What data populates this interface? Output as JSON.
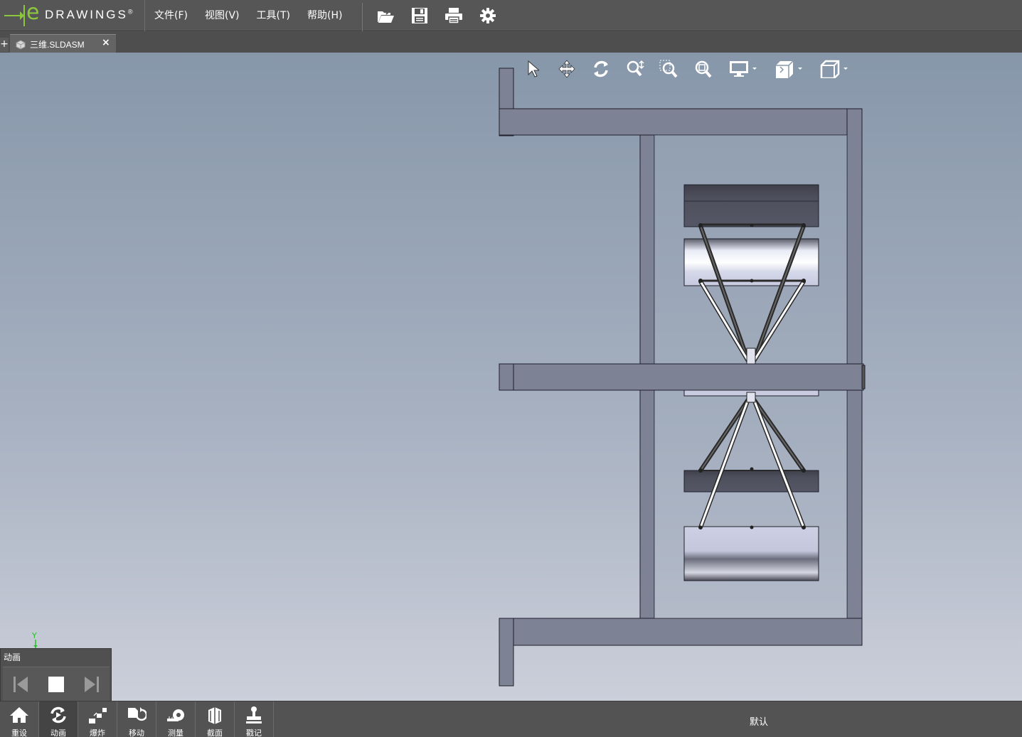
{
  "app": {
    "logo_letter": "e",
    "logo_word": "DRAWINGS",
    "logo_mark": "®"
  },
  "menu": {
    "items": [
      {
        "label": "文件(F)"
      },
      {
        "label": "视图(V)"
      },
      {
        "label": "工具(T)"
      },
      {
        "label": "帮助(H)"
      }
    ]
  },
  "toolbar": {
    "icons": [
      "open-icon",
      "save-icon",
      "print-icon",
      "gear-icon"
    ]
  },
  "tabs": {
    "add_label": "+",
    "active": {
      "title": "三维.SLDASM",
      "close_label": "×"
    }
  },
  "heads_up_toolbar": {
    "icons": [
      "select-icon",
      "pan-icon",
      "rotate-icon",
      "zoom-icon",
      "zoom-to-area-icon",
      "zoom-to-fit-icon",
      "display-style-icon",
      "view-orientation-icon",
      "standard-views-icon"
    ]
  },
  "triad": {
    "axis_label": "Y"
  },
  "animation_panel": {
    "title": "动画",
    "controls": [
      "previous-icon",
      "stop-icon",
      "next-icon"
    ]
  },
  "bottom_toolbar": {
    "items": [
      {
        "label": "重设",
        "icon": "home-icon"
      },
      {
        "label": "动画",
        "icon": "animate-icon",
        "active": true
      },
      {
        "label": "爆炸",
        "icon": "explode-icon"
      },
      {
        "label": "移动",
        "icon": "move-icon"
      },
      {
        "label": "测量",
        "icon": "measure-icon"
      },
      {
        "label": "截面",
        "icon": "section-icon"
      },
      {
        "label": "戳记",
        "icon": "stamp-icon"
      }
    ],
    "configuration": "默认"
  },
  "colors": {
    "brand_green": "#8cc63f",
    "frame_gray": "#7e8295",
    "background_top": "#8797aa",
    "background_bottom": "#cbcfda"
  }
}
